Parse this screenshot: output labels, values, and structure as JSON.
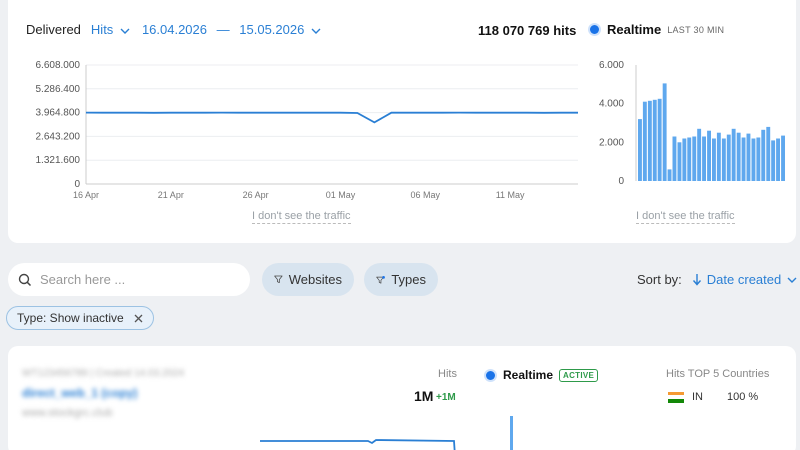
{
  "filters": {
    "metric_label": "Delivered",
    "metric_value": "Hits",
    "date_from": "16.04.2026",
    "date_separator": "—",
    "date_to": "15.05.2026"
  },
  "summary": {
    "total_hits": "118 070 769 hits"
  },
  "realtime": {
    "title": "Realtime",
    "subtitle": "LAST 30 MIN"
  },
  "no_traffic_link": "I don't see the traffic",
  "chart_data": [
    {
      "type": "line",
      "yticks": [
        "6.608.000",
        "5.286.400",
        "3.964.800",
        "2.643.200",
        "1.321.600",
        "0"
      ],
      "ylim": [
        0,
        6608000
      ],
      "xticks": [
        "16 Apr",
        "21 Apr",
        "26 Apr",
        "01 May",
        "06 May",
        "11 May"
      ],
      "x": [
        "16 Apr",
        "17 Apr",
        "18 Apr",
        "19 Apr",
        "20 Apr",
        "21 Apr",
        "22 Apr",
        "23 Apr",
        "24 Apr",
        "25 Apr",
        "26 Apr",
        "27 Apr",
        "28 Apr",
        "29 Apr",
        "30 Apr",
        "01 May",
        "02 May",
        "03 May",
        "04 May",
        "05 May",
        "06 May",
        "07 May",
        "08 May",
        "09 May",
        "10 May",
        "11 May",
        "12 May",
        "13 May",
        "14 May",
        "15 May"
      ],
      "values": [
        3964800,
        3960000,
        3958000,
        3962000,
        3955000,
        3960000,
        3958000,
        3962000,
        3964000,
        3959000,
        3957000,
        3960000,
        3962000,
        3958000,
        3961000,
        3960000,
        3940000,
        3420000,
        3960000,
        3962000,
        3958000,
        3960000,
        3964000,
        3957000,
        3960000,
        3962000,
        3958000,
        3955000,
        3960000,
        3958000
      ],
      "color": "#2a7fd4"
    },
    {
      "type": "bar",
      "yticks": [
        "6.000",
        "4.000",
        "2.000",
        "0"
      ],
      "ylim": [
        0,
        6000
      ],
      "values": [
        3200,
        4100,
        4150,
        4200,
        4250,
        5050,
        600,
        2300,
        2000,
        2200,
        2250,
        2300,
        2700,
        2300,
        2600,
        2200,
        2500,
        2200,
        2400,
        2700,
        2500,
        2250,
        2450,
        2200,
        2250,
        2650,
        2800,
        2100,
        2200,
        2350
      ],
      "color": "#5fa8ee"
    }
  ],
  "search": {
    "placeholder": "Search here ..."
  },
  "filter_pills": {
    "websites": "Websites",
    "types": "Types"
  },
  "sort": {
    "label": "Sort by:",
    "value": "Date created"
  },
  "active_chip": {
    "label": "Type: Show inactive"
  },
  "site": {
    "meta": "WT123456789 | Created 14.03.2024",
    "name": "direct_web_1 (copy)",
    "url": "www.stockgrc.club",
    "hits_label": "Hits",
    "hits_value": "1M",
    "hits_delta": "+1M",
    "realtime_label": "Realtime",
    "realtime_badge": "ACTIVE",
    "top_label": "Hits TOP 5 Countries",
    "countries": [
      {
        "code": "IN",
        "pct": "100 %"
      }
    ]
  }
}
